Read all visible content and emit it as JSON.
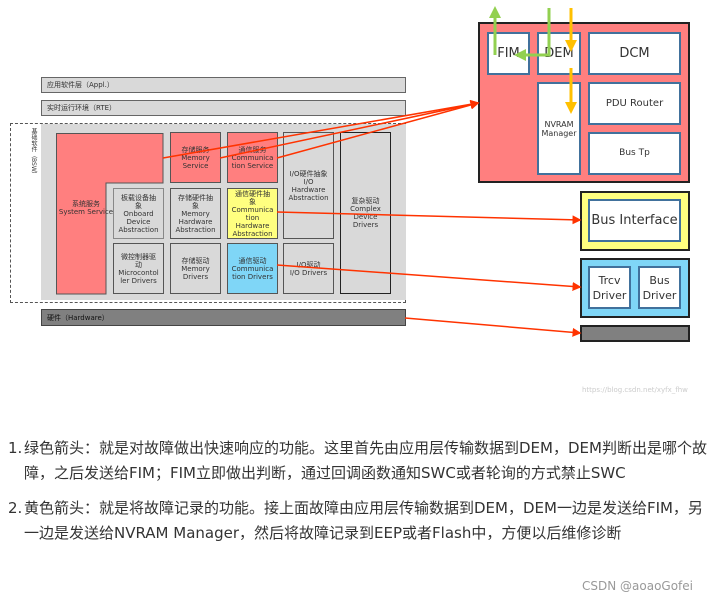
{
  "diagram": {
    "appl": "应用软件层（Appl.）",
    "rte": "实时运行环境（RTE）",
    "bsw": "基础软件（BSW）",
    "system_service": "系统服务\nSystem Service",
    "memory_service": "存储服务\nMemory\nService",
    "comm_service": "通信服务\nCommunica\ntion Service",
    "io_hw_abstraction": "I/O硬件抽象\nI/O\nHardware\nAbstraction",
    "complex_drivers": "复杂驱动\nComplex\nDevice\nDrivers",
    "onboard_abstraction": "板载设备抽\n象\nOnboard\nDevice\nAbstraction",
    "memory_hw_abstraction": "存储硬件抽\n象\nMemory\nHardware\nAbstraction",
    "comm_hw_abstraction": "通信硬件抽\n象\nCommunica\ntion\nHardware\nAbstraction",
    "microcontroller_drivers": "微控制器驱\n动\nMicrocontol\nler Drivers",
    "memory_drivers": "存储驱动\nMemory\nDrivers",
    "comm_drivers": "通信驱动\nCommunica\ntion Drivers",
    "io_drivers": "I/O驱动\nI/O Drivers",
    "hardware": "硬件（Hardware）",
    "fim": "FIM",
    "dem": "DEM",
    "dcm": "DCM",
    "nvram": "NVRAM\nManager",
    "pdu_router": "PDU Router",
    "bus_tp": "Bus Tp",
    "bus_interface": "Bus Interface",
    "trcv_driver": "Trcv\nDriver",
    "bus_driver": "Bus\nDriver",
    "watermark": "https://blog.csdn.net/xyfx_fhw",
    "colors": {
      "service": "#ff7f7f",
      "hw_abstraction": "#ffff80",
      "drivers": "#7fd6f7",
      "green_arrow": "#92d050",
      "yellow_arrow": "#ffc000",
      "red_arrow": "#ff3300"
    }
  },
  "list": [
    {
      "num": "1.",
      "text": "绿色箭头：就是对故障做出快速响应的功能。这里首先由应用层传输数据到DEM，DEM判断出是哪个故障，之后发送给FIM；FIM立即做出判断，通过回调函数通知SWC或者轮询的方式禁止SWC"
    },
    {
      "num": "2.",
      "text": "黄色箭头：就是将故障记录的功能。接上面故障由应用层传输数据到DEM，DEM一边是发送给FIM，另一边是发送给NVRAM Manager，然后将故障记录到EEP或者Flash中，方便以后维修诊断"
    }
  ],
  "footer_watermark": "CSDN @aoaoGofei"
}
